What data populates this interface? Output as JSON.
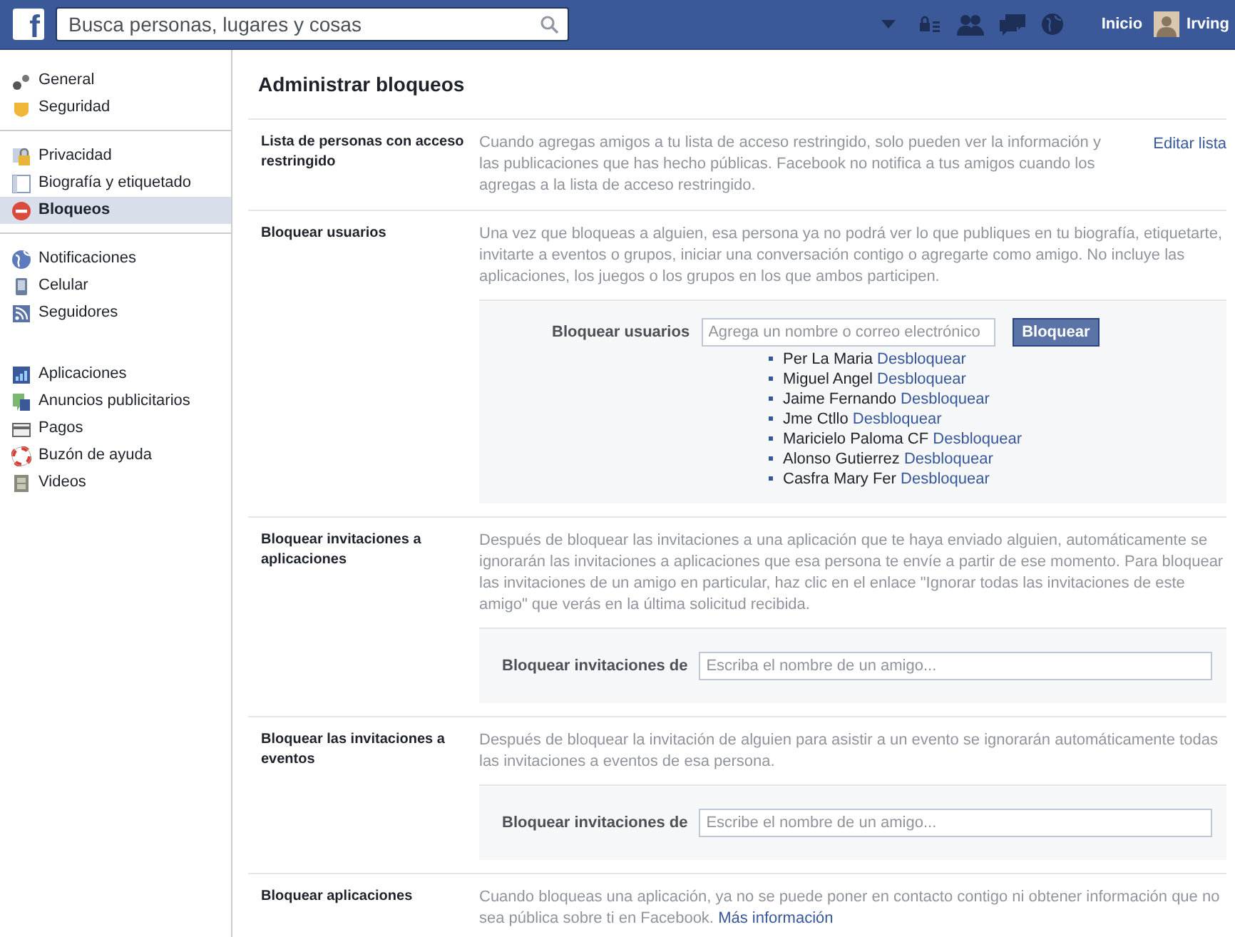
{
  "topbar": {
    "logo": "f",
    "search": {
      "placeholder": "Busca personas, lugares y cosas"
    },
    "home": "Inicio",
    "user": "Irving"
  },
  "sidebar": {
    "groups": [
      [
        {
          "label": "General",
          "selected": false
        },
        {
          "label": "Seguridad",
          "selected": false
        }
      ],
      [
        {
          "label": "Privacidad",
          "selected": false
        },
        {
          "label": "Biografía y etiquetado",
          "selected": false
        },
        {
          "label": "Bloqueos",
          "selected": true
        }
      ],
      [
        {
          "label": "Notificaciones",
          "selected": false
        },
        {
          "label": "Celular",
          "selected": false
        },
        {
          "label": "Seguidores",
          "selected": false
        }
      ],
      [
        {
          "label": "Aplicaciones",
          "selected": false
        },
        {
          "label": "Anuncios publicitarios",
          "selected": false
        },
        {
          "label": "Pagos",
          "selected": false
        },
        {
          "label": "Buzón de ayuda",
          "selected": false
        },
        {
          "label": "Videos",
          "selected": false
        }
      ]
    ]
  },
  "page_title": "Administrar bloqueos",
  "sections": [
    {
      "kind": "plain",
      "label": "Lista de personas con acceso restringido",
      "description": "Cuando agregas amigos a tu lista de acceso restringido, solo pueden ver la información y las publicaciones que has hecho públicas. Facebook no notifica a tus amigos cuando los agregas a la lista de acceso restringido.",
      "action": "Editar lista"
    },
    {
      "kind": "block_users",
      "label": "Bloquear usuarios",
      "description": "Una vez que bloqueas a alguien, esa persona ya no podrá ver lo que publiques en tu biografía, etiquetarte, invitarte a eventos o grupos, iniciar una conversación contigo o agregarte como amigo. No incluye las aplicaciones, los juegos o los grupos en los que ambos participen.",
      "field_label": "Bloquear usuarios",
      "placeholder": "Agrega un nombre o correo electrónico",
      "button": "Bloquear",
      "blocked": [
        {
          "name": "Per La Maria",
          "link": "Desbloquear"
        },
        {
          "name": "Miguel Angel",
          "link": "Desbloquear"
        },
        {
          "name": "Jaime Fernando",
          "link": "Desbloquear"
        },
        {
          "name": "Jme Ctllo",
          "link": "Desbloquear"
        },
        {
          "name": "Maricielo Paloma CF",
          "link": "Desbloquear"
        },
        {
          "name": "Alonso Gutierrez",
          "link": "Desbloquear"
        },
        {
          "name": "Casfra Mary Fer",
          "link": "Desbloquear"
        }
      ]
    },
    {
      "kind": "invite",
      "label": "Bloquear invitaciones a aplicaciones",
      "description": "Después de bloquear las invitaciones a una aplicación que te haya enviado alguien, automáticamente se ignorarán las invitaciones a aplicaciones que esa persona te envíe a partir de ese momento. Para bloquear las invitaciones de un amigo en particular, haz clic en el enlace \"Ignorar todas las invitaciones de este amigo\" que verás en la última solicitud recibida.",
      "field_label": "Bloquear invitaciones de",
      "placeholder": "Escriba el nombre de un amigo..."
    },
    {
      "kind": "invite",
      "label": "Bloquear las invitaciones a eventos",
      "description": "Después de bloquear la invitación de alguien para asistir a un evento se ignorarán automáticamente todas las invitaciones a eventos de esa persona.",
      "field_label": "Bloquear invitaciones de",
      "placeholder": "Escribe el nombre de un amigo..."
    },
    {
      "kind": "plain",
      "label": "Bloquear aplicaciones",
      "description": "Cuando bloqueas una aplicación, ya no se puede poner en contacto contigo ni obtener información que no sea pública sobre ti en Facebook.",
      "inline_link": "Más información"
    }
  ]
}
